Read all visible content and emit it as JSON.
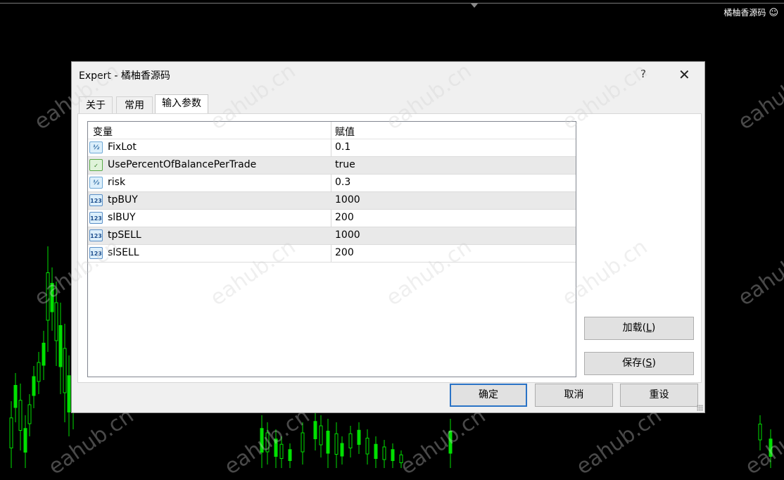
{
  "chart": {
    "title": "橘柚香源码",
    "smiley": "☺"
  },
  "watermark": "eahub.cn",
  "dialog": {
    "title": "Expert - 橘柚香源码",
    "help": "?",
    "close": "✕",
    "tabs": [
      {
        "label": "关于",
        "active": false
      },
      {
        "label": "常用",
        "active": false
      },
      {
        "label": "输入参数",
        "active": true
      }
    ],
    "grid": {
      "headers": {
        "variable": "变量",
        "value": "赋值"
      },
      "rows": [
        {
          "icon": "fraction-icon",
          "icon_text": "½",
          "name": "FixLot",
          "value": "0.1"
        },
        {
          "icon": "bool-icon",
          "icon_text": "✓",
          "name": "UsePercentOfBalancePerTrade",
          "value": "true"
        },
        {
          "icon": "fraction-icon",
          "icon_text": "½",
          "name": "risk",
          "value": "0.3"
        },
        {
          "icon": "integer-icon",
          "icon_text": "123",
          "name": "tpBUY",
          "value": "1000"
        },
        {
          "icon": "integer-icon",
          "icon_text": "123",
          "name": "slBUY",
          "value": "200"
        },
        {
          "icon": "integer-icon",
          "icon_text": "123",
          "name": "tpSELL",
          "value": "1000"
        },
        {
          "icon": "integer-icon",
          "icon_text": "123",
          "name": "slSELL",
          "value": "200"
        }
      ]
    },
    "buttons": {
      "load": {
        "label": "加载(",
        "key": "L",
        "suffix": ")"
      },
      "save": {
        "label": "保存(",
        "key": "S",
        "suffix": ")"
      },
      "ok": "确定",
      "cancel": "取消",
      "reset": "重设"
    }
  },
  "colors": {
    "candle": "#00e000",
    "background": "#000000",
    "dialog": "#f0f0f0",
    "accent": "#2a73c6"
  }
}
